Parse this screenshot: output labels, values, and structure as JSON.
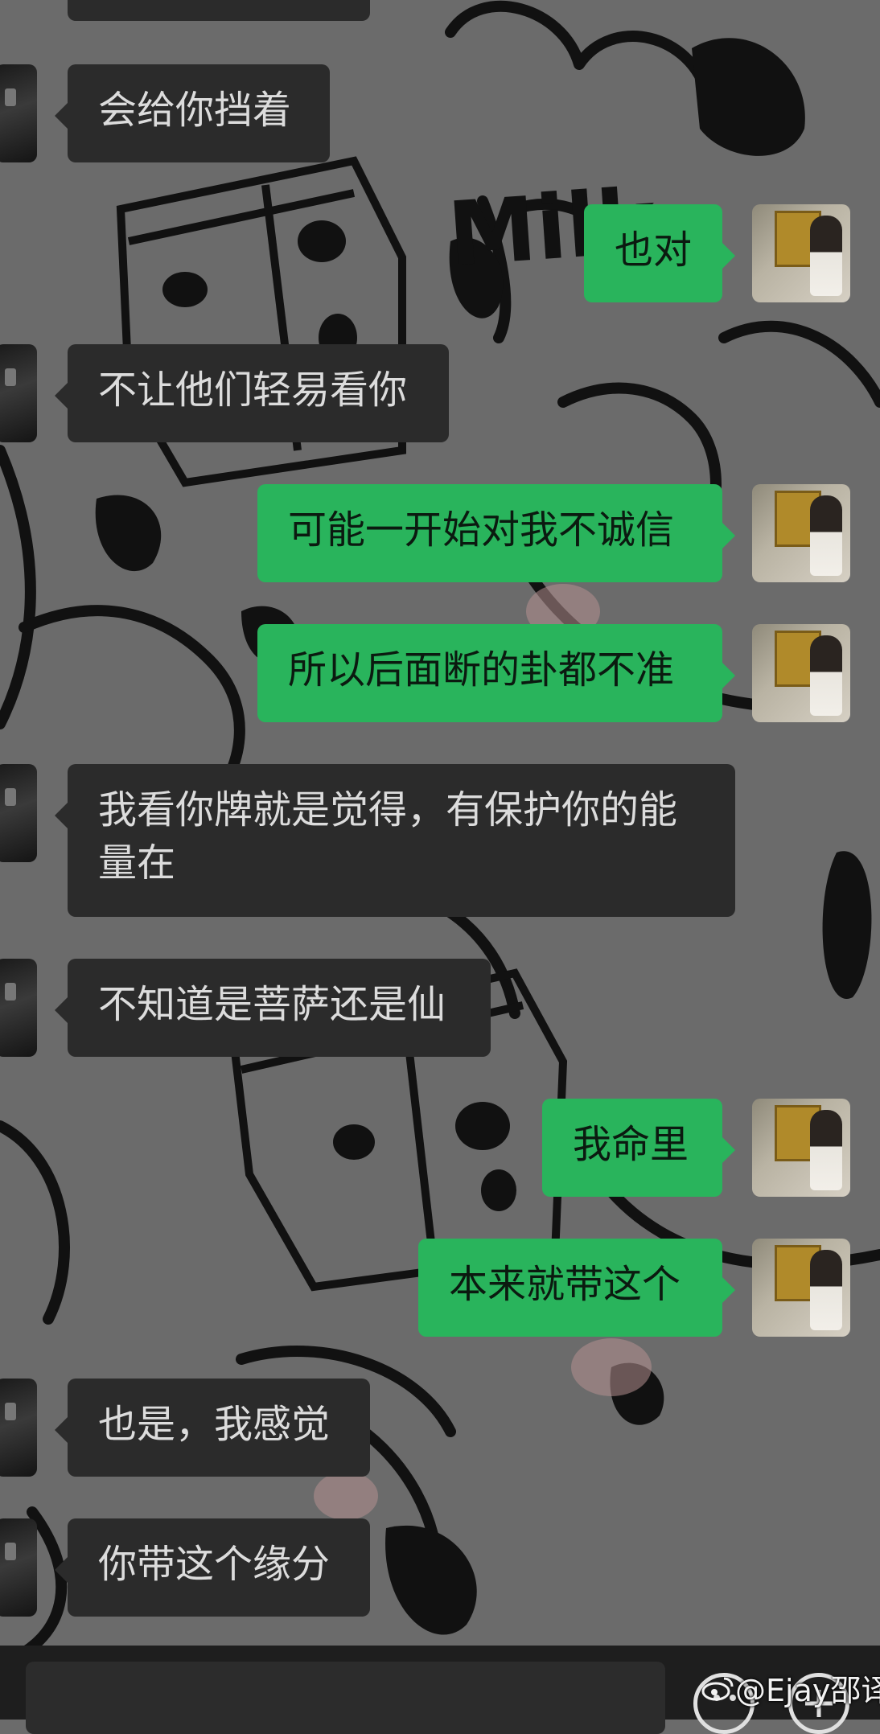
{
  "messages": [
    {
      "side": "in",
      "text": ""
    },
    {
      "side": "in",
      "text": "会给你挡着"
    },
    {
      "side": "out",
      "text": "也对"
    },
    {
      "side": "in",
      "text": "不让他们轻易看你"
    },
    {
      "side": "out",
      "text": "可能一开始对我不诚信"
    },
    {
      "side": "out",
      "text": "所以后面断的卦都不准"
    },
    {
      "side": "in",
      "text": "我看你牌就是觉得，有保护你的能\n量在"
    },
    {
      "side": "in",
      "text": "不知道是菩萨还是仙"
    },
    {
      "side": "out",
      "text": "我命里"
    },
    {
      "side": "out",
      "text": "本来就带这个"
    },
    {
      "side": "in",
      "text": "也是，我感觉"
    },
    {
      "side": "in",
      "text": "你带这个缘分"
    }
  ],
  "colors": {
    "incoming_bubble": "#2b2b2b",
    "outgoing_bubble": "#29b45c",
    "background": "#6b6b6b"
  },
  "background_art": {
    "text": "Milk"
  },
  "watermark": {
    "text": "@Ejay邵译瑾"
  },
  "icons": [
    "emoji-icon",
    "plus-icon",
    "weibo-logo-icon"
  ]
}
